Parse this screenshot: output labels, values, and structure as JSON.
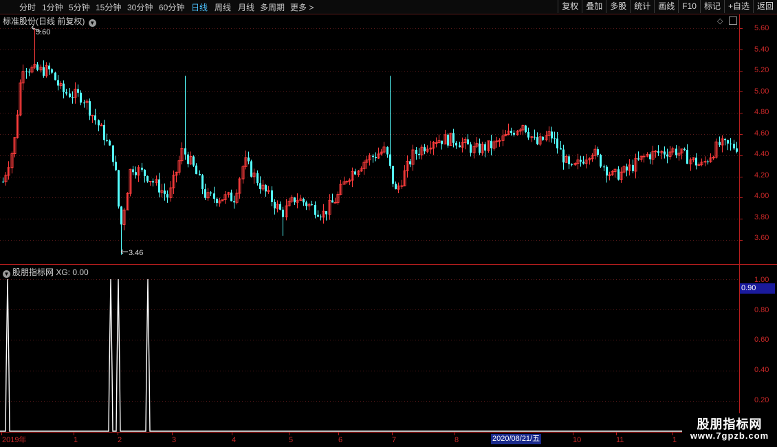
{
  "toolbar": {
    "periods": [
      "分时",
      "1分钟",
      "5分钟",
      "15分钟",
      "30分钟",
      "60分钟",
      "日线",
      "周线",
      "月线",
      "多周期",
      "更多 >"
    ],
    "active_period": "日线",
    "right_buttons": [
      "复权",
      "叠加",
      "多股",
      "统计",
      "画线",
      "F10",
      "标记",
      "+自选",
      "返回"
    ]
  },
  "price_panel": {
    "title": "标准股份(日线 前复权)",
    "y_ticks": [
      "5.60",
      "5.40",
      "5.20",
      "5.00",
      "4.80",
      "4.60",
      "4.40",
      "4.20",
      "4.00",
      "3.80",
      "3.60"
    ],
    "high_label": "5.60",
    "low_label": "3.46"
  },
  "indicator_panel": {
    "title": "股朋指标网 XG: 0.00",
    "y_ticks": [
      "1.00",
      "0.80",
      "0.60",
      "0.40",
      "0.20"
    ],
    "current_value": "0.90"
  },
  "x_axis": {
    "labels": [
      "2019年",
      "1",
      "2",
      "3",
      "4",
      "5",
      "6",
      "7",
      "8",
      "10",
      "11",
      "1"
    ],
    "highlight_date": "2020/08/21/五"
  },
  "watermark": {
    "line1": "股朋指标网",
    "line2": "www.7gpzb.com"
  },
  "colors": {
    "up": "#ff3c3c",
    "down": "#54ffff",
    "grid": "#5a1a1a",
    "axis": "#b81e1e",
    "active_tab": "#4cc3ff"
  },
  "chart_data": {
    "type": "candlestick",
    "ylim": [
      3.46,
      5.6
    ],
    "yticks": [
      5.6,
      5.4,
      5.2,
      5.0,
      4.8,
      4.6,
      4.4,
      4.2,
      4.0,
      3.8,
      3.6
    ],
    "max": 5.6,
    "min": 3.46,
    "indicator": {
      "name": "XG",
      "value": 0.0,
      "ylim": [
        0,
        1.0
      ],
      "signal_positions": [
        0.01,
        0.15,
        0.16,
        0.2
      ]
    }
  }
}
